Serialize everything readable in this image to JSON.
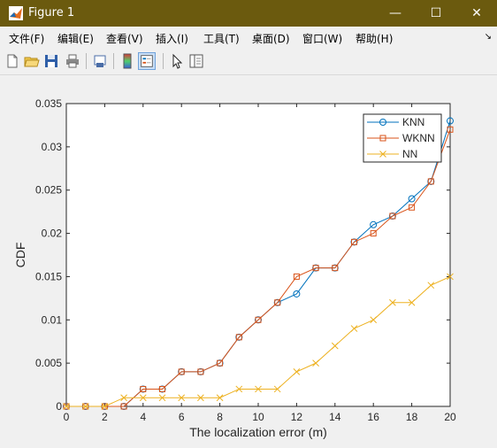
{
  "window": {
    "title": "Figure 1",
    "minimize": "—",
    "maximize": "☐",
    "close": "✕"
  },
  "menu": [
    "文件(F)",
    "编辑(E)",
    "查看(V)",
    "插入(I)",
    "工具(T)",
    "桌面(D)",
    "窗口(W)",
    "帮助(H)"
  ],
  "toolbar_icons": [
    "new-file-icon",
    "open-folder-icon",
    "save-icon",
    "print-icon",
    "print-preview-icon",
    "colorbar-icon",
    "legend-icon",
    "pointer-icon",
    "property-editor-icon"
  ],
  "chart_data": {
    "type": "line",
    "xlabel": "The localization error (m)",
    "ylabel": "CDF",
    "xlim": [
      0,
      20
    ],
    "ylim": [
      0,
      0.035
    ],
    "xticks": [
      0,
      2,
      4,
      6,
      8,
      10,
      12,
      14,
      16,
      18,
      20
    ],
    "yticks": [
      "0",
      "0.005",
      "0.01",
      "0.015",
      "0.02",
      "0.025",
      "0.03",
      "0.035"
    ],
    "ytick_values": [
      0,
      0.005,
      0.01,
      0.015,
      0.02,
      0.025,
      0.03,
      0.035
    ],
    "grid": false,
    "legend_position": "top-right",
    "x": [
      0,
      1,
      2,
      3,
      4,
      5,
      6,
      7,
      8,
      9,
      10,
      11,
      12,
      13,
      14,
      15,
      16,
      17,
      18,
      19,
      20
    ],
    "series": [
      {
        "name": "KNN",
        "color": "#0072bd",
        "marker": "circle",
        "values": [
          0,
          0,
          0,
          0,
          0.002,
          0.002,
          0.004,
          0.004,
          0.005,
          0.008,
          0.01,
          0.012,
          0.013,
          0.016,
          0.016,
          0.019,
          0.021,
          0.022,
          0.024,
          0.026,
          0.033
        ]
      },
      {
        "name": "WKNN",
        "color": "#d95319",
        "marker": "square",
        "values": [
          0,
          0,
          0,
          0,
          0.002,
          0.002,
          0.004,
          0.004,
          0.005,
          0.008,
          0.01,
          0.012,
          0.015,
          0.016,
          0.016,
          0.019,
          0.02,
          0.022,
          0.023,
          0.026,
          0.032
        ]
      },
      {
        "name": "NN",
        "color": "#edb120",
        "marker": "x",
        "values": [
          0,
          0,
          0,
          0.001,
          0.001,
          0.001,
          0.001,
          0.001,
          0.001,
          0.002,
          0.002,
          0.002,
          0.004,
          0.005,
          0.007,
          0.009,
          0.01,
          0.012,
          0.012,
          0.014,
          0.015
        ]
      }
    ]
  }
}
